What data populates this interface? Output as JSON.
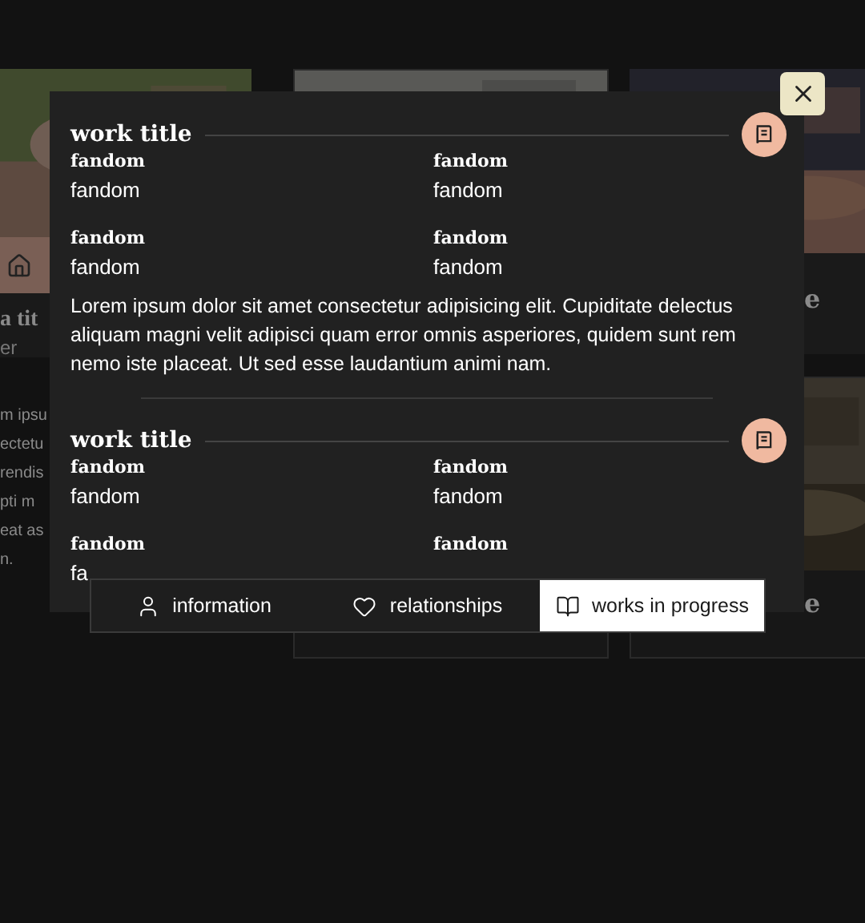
{
  "background": {
    "left_card": {
      "title": "a tit",
      "subtitle": "er",
      "text_lines": [
        "m ipsu",
        "ectetu",
        "rendis",
        "pti m",
        "eat as",
        "n."
      ]
    },
    "right_cards": [
      {
        "title": "e"
      },
      {
        "title": "e"
      }
    ]
  },
  "modal": {
    "works": [
      {
        "title": "work title",
        "fields": [
          {
            "label": "fandom",
            "value": "fandom"
          },
          {
            "label": "fandom",
            "value": "fandom"
          },
          {
            "label": "fandom",
            "value": "fandom"
          },
          {
            "label": "fandom",
            "value": "fandom"
          }
        ],
        "description": "Lorem ipsum dolor sit amet consectetur adipisicing elit. Cupiditate delectus aliquam magni velit adipisci quam error omnis asperiores, quidem sunt rem nemo iste placeat. Ut sed esse laudantium animi nam."
      },
      {
        "title": "work title",
        "fields": [
          {
            "label": "fandom",
            "value": "fandom"
          },
          {
            "label": "fandom",
            "value": "fandom"
          },
          {
            "label": "fandom",
            "value": "fa"
          },
          {
            "label": "fandom"
          }
        ]
      }
    ]
  },
  "tabs": [
    {
      "label": "information",
      "kind": "user",
      "selected": false
    },
    {
      "label": "relationships",
      "kind": "heart",
      "selected": false
    },
    {
      "label": "works in progress",
      "kind": "book",
      "selected": true
    }
  ]
}
